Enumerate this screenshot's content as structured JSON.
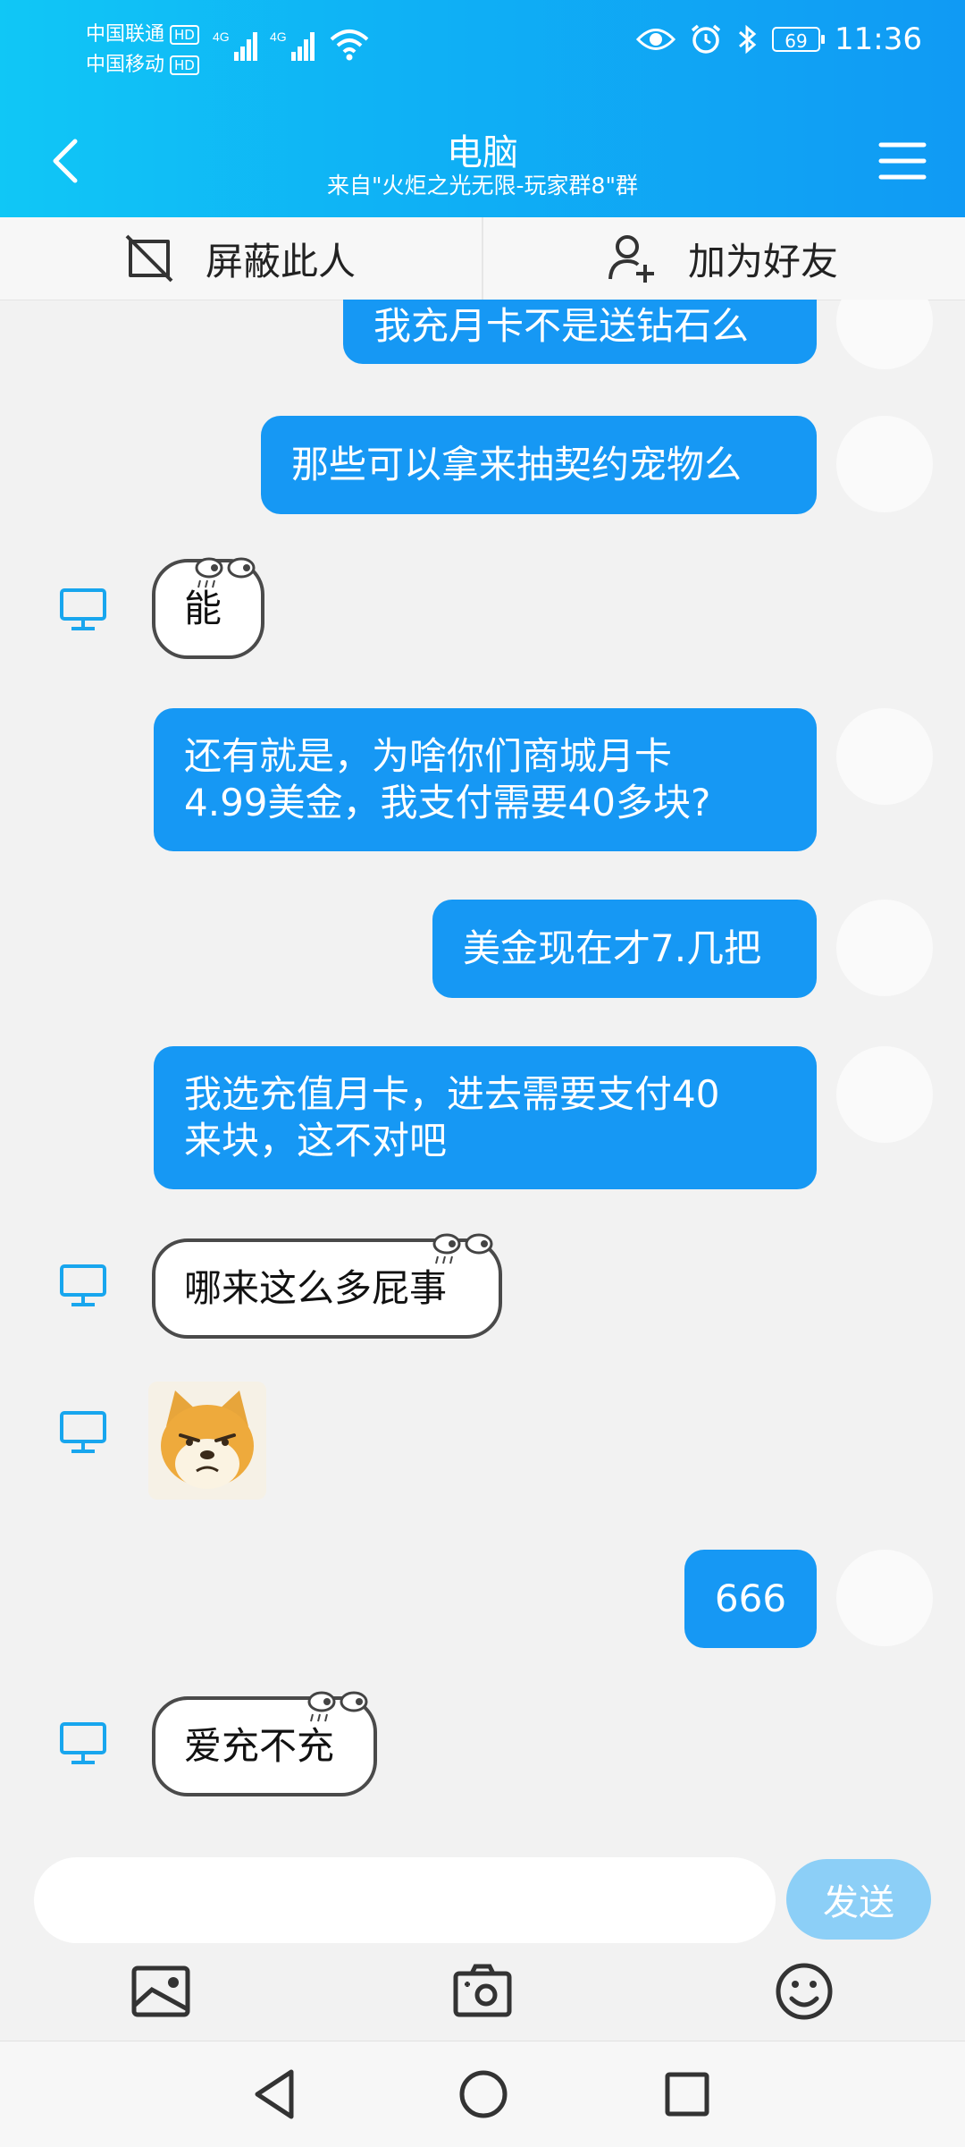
{
  "status_bar": {
    "carrier1": "中国联通",
    "carrier2": "中国移动",
    "hd": "HD",
    "net": "4G",
    "battery": "69",
    "time": "11:36"
  },
  "header": {
    "title": "电脑",
    "subtitle": "来自\"火炬之光无限-玩家群8\"群"
  },
  "action_bar": {
    "block_label": "屏蔽此人",
    "add_friend_label": "加为好友"
  },
  "messages": [
    {
      "side": "out",
      "text": "我充月卡不是送钻石么"
    },
    {
      "side": "out",
      "text": "那些可以拿来抽契约宠物么"
    },
    {
      "side": "in",
      "text": "能"
    },
    {
      "side": "out",
      "text": "还有就是，为啥你们商城月卡4.99美金，我支付需要40多块？",
      "line1": "还有就是，为啥你们商城月卡",
      "line2": "4.99美金，我支付需要40多块?"
    },
    {
      "side": "out",
      "text": "美金现在才7.几把"
    },
    {
      "side": "out",
      "text": "我选充值月卡，进去需要支付40来块，这不对吧",
      "line1": "我选充值月卡，进去需要支付40",
      "line2": "来块，这不对吧"
    },
    {
      "side": "in",
      "text": "哪来这么多屁事"
    },
    {
      "side": "in",
      "type": "sticker",
      "sticker": "shiba-sticker"
    },
    {
      "side": "out",
      "text": "666"
    },
    {
      "side": "in",
      "text": "爱充不充"
    }
  ],
  "input": {
    "placeholder": "",
    "send_label": "发送"
  },
  "colors": {
    "header_start": "#10c7f6",
    "header_end": "#109af4",
    "bubble_out": "#1698f4",
    "send_disabled": "#8ccff7"
  }
}
